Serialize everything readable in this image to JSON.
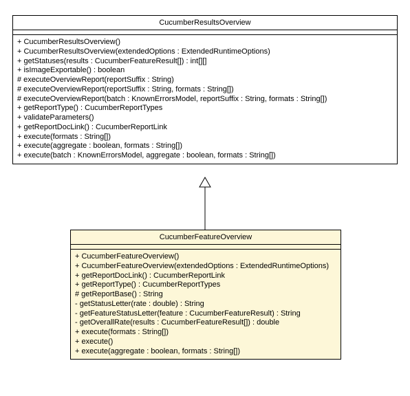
{
  "parent": {
    "title": "CucumberResultsOverview",
    "ops": [
      "+ CucumberResultsOverview()",
      "+ CucumberResultsOverview(extendedOptions : ExtendedRuntimeOptions)",
      "+ getStatuses(results : CucumberFeatureResult[]) : int[][]",
      "+ isImageExportable() : boolean",
      "# executeOverviewReport(reportSuffix : String)",
      "# executeOverviewReport(reportSuffix : String, formats : String[])",
      "# executeOverviewReport(batch : KnownErrorsModel, reportSuffix : String, formats : String[])",
      "+ getReportType() : CucumberReportTypes",
      "+ validateParameters()",
      "+ getReportDocLink() : CucumberReportLink",
      "+ execute(formats : String[])",
      "+ execute(aggregate : boolean, formats : String[])",
      "+ execute(batch : KnownErrorsModel, aggregate : boolean, formats : String[])"
    ]
  },
  "child": {
    "title": "CucumberFeatureOverview",
    "ops": [
      "+ CucumberFeatureOverview()",
      "+ CucumberFeatureOverview(extendedOptions : ExtendedRuntimeOptions)",
      "+ getReportDocLink() : CucumberReportLink",
      "+ getReportType() : CucumberReportTypes",
      "# getReportBase() : String",
      "- getStatusLetter(rate : double) : String",
      "- getFeatureStatusLetter(feature : CucumberFeatureResult) : String",
      "- getOverallRate(results : CucumberFeatureResult[]) : double",
      "+ execute(formats : String[])",
      "+ execute()",
      "+ execute(aggregate : boolean, formats : String[])"
    ]
  },
  "chart_data": {
    "type": "table",
    "title": "UML class inheritance diagram",
    "relationship": "generalization",
    "parent": "CucumberResultsOverview",
    "child": "CucumberFeatureOverview"
  }
}
